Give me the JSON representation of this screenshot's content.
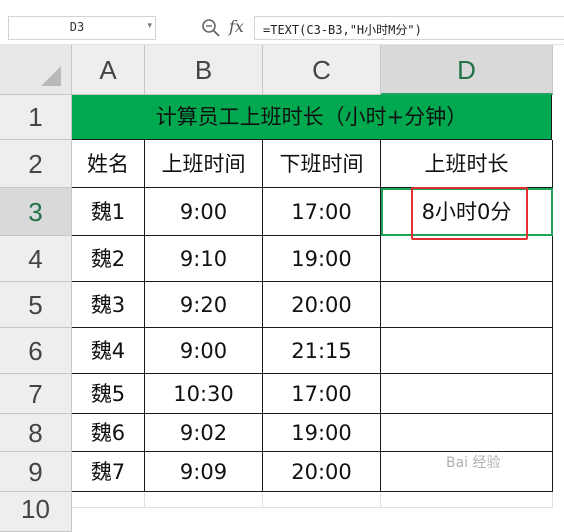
{
  "toolbar": {
    "name_box": "D3",
    "fx_label": "fx",
    "formula": "=TEXT(C3-B3,\"H小时M分\")"
  },
  "columns": [
    "A",
    "B",
    "C",
    "D"
  ],
  "rows": [
    "1",
    "2",
    "3",
    "4",
    "5",
    "6",
    "7",
    "8",
    "9",
    "10"
  ],
  "sheet": {
    "title": "计算员工上班时长（小时+分钟）",
    "headers": {
      "name": "姓名",
      "start": "上班时间",
      "end": "下班时间",
      "duration": "上班时长"
    },
    "records": [
      {
        "name": "魏1",
        "start": "9:00",
        "end": "17:00",
        "duration": "8小时0分"
      },
      {
        "name": "魏2",
        "start": "9:10",
        "end": "19:00",
        "duration": ""
      },
      {
        "name": "魏3",
        "start": "9:20",
        "end": "20:00",
        "duration": ""
      },
      {
        "name": "魏4",
        "start": "9:00",
        "end": "21:15",
        "duration": ""
      },
      {
        "name": "魏5",
        "start": "10:30",
        "end": "17:00",
        "duration": ""
      },
      {
        "name": "魏6",
        "start": "9:02",
        "end": "19:00",
        "duration": ""
      },
      {
        "name": "魏7",
        "start": "9:09",
        "end": "20:00",
        "duration": ""
      }
    ]
  },
  "watermark": "Bai 经验",
  "colors": {
    "title_fill": "#00a84f",
    "selection": "#1ea35a",
    "highlight": "#e03030"
  }
}
